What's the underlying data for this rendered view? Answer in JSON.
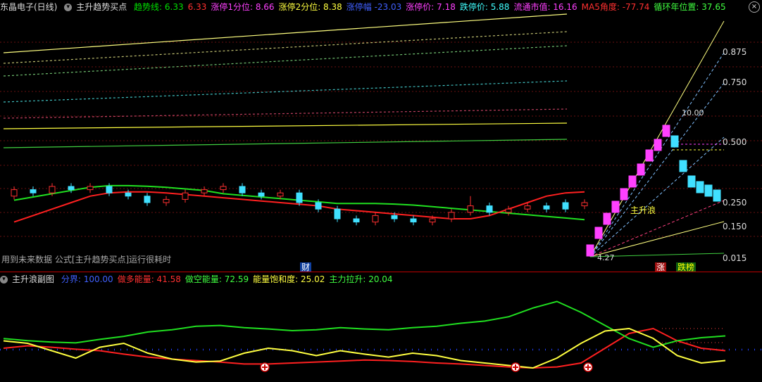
{
  "main": {
    "stock": "东晶电子(日线)",
    "indicator": "主升趋势买点",
    "params": [
      {
        "label": "趋势线:",
        "value": "6.33",
        "color": "#00e000"
      },
      {
        "label": "",
        "value": "6.33",
        "color": "#ff3030"
      },
      {
        "label": "涨停1分位:",
        "value": "8.66",
        "color": "#ff40ff"
      },
      {
        "label": "涨停2分位:",
        "value": "8.38",
        "color": "#ffff40"
      },
      {
        "label": "涨停幅",
        "value": "-23.03",
        "color": "#4060ff"
      },
      {
        "label": "涨停价:",
        "value": "7.18",
        "color": "#ff40ff"
      },
      {
        "label": "跌停价:",
        "value": "5.88",
        "color": "#40ffff"
      },
      {
        "label": "流通市值:",
        "value": "16.16",
        "color": "#ff40ff"
      },
      {
        "label": "MA5角度:",
        "value": "-77.74",
        "color": "#ff3030"
      },
      {
        "label": "循环年位置:",
        "value": "37.65",
        "color": "#40ff40"
      }
    ],
    "close": "×",
    "right_labels": [
      "0.875",
      "0.750",
      "0.500",
      "0.250",
      "0.150",
      "0.015"
    ],
    "note": "用到未来数据  公式[主升趋势买点]运行很耗时",
    "tags": [
      {
        "text": "财",
        "bg": "#1040a0",
        "color": "#fff"
      },
      {
        "text": "涨",
        "bg": "#a01010",
        "color": "#fff"
      },
      {
        "text": "跌榜",
        "bg": "#106010",
        "color": "#ff0"
      }
    ],
    "annot_high": "10.00",
    "annot_low": "4.27",
    "annot_wave": "主升浪"
  },
  "sub": {
    "name": "主升浪副图",
    "params": [
      {
        "label": "分界:",
        "value": "100.00",
        "color": "#4060ff"
      },
      {
        "label": "做多能量:",
        "value": "41.58",
        "color": "#ff3030"
      },
      {
        "label": "做空能量:",
        "value": "72.59",
        "color": "#40ff40"
      },
      {
        "label": "能量饱和度:",
        "value": "25.02",
        "color": "#ffff40"
      },
      {
        "label": "主力拉升:",
        "value": "20.04",
        "color": "#40ff40"
      }
    ]
  },
  "chart_data": [
    {
      "type": "candlestick",
      "series": [
        {
          "name": "趋势线",
          "values": [
            5.9,
            6.0,
            6.1,
            6.2,
            6.3,
            6.35,
            6.35,
            6.33,
            6.3,
            6.25,
            6.2,
            6.1,
            6.05,
            6.0,
            5.95,
            5.9,
            5.85,
            5.8,
            5.8,
            5.8,
            5.78,
            5.75,
            5.7,
            5.65,
            5.6,
            5.55,
            5.5,
            5.45,
            5.4,
            5.35,
            5.3
          ]
        },
        {
          "name": "",
          "values": [
            5.4,
            5.6,
            5.8,
            6.0,
            6.2,
            6.3,
            6.33,
            6.33,
            6.3,
            6.25,
            6.2,
            6.15,
            6.1,
            6.05,
            6.0,
            5.95,
            5.9,
            5.8,
            5.75,
            5.7,
            5.65,
            5.6,
            5.55,
            5.5,
            5.5,
            5.6,
            5.8,
            6.0,
            6.2,
            6.3,
            6.33
          ]
        }
      ],
      "candles": [
        [
          6.2,
          6.4,
          6.5,
          6.1,
          "up"
        ],
        [
          6.4,
          6.3,
          6.5,
          6.2,
          "down"
        ],
        [
          6.3,
          6.5,
          6.6,
          6.2,
          "up"
        ],
        [
          6.5,
          6.4,
          6.6,
          6.3,
          "down"
        ],
        [
          6.4,
          6.5,
          6.6,
          6.3,
          "up"
        ],
        [
          6.5,
          6.3,
          6.6,
          6.2,
          "down"
        ],
        [
          6.3,
          6.2,
          6.4,
          6.1,
          "down"
        ],
        [
          6.2,
          6.0,
          6.3,
          5.9,
          "down"
        ],
        [
          6.0,
          6.1,
          6.2,
          5.9,
          "up"
        ],
        [
          6.1,
          6.3,
          6.4,
          6.0,
          "up"
        ],
        [
          6.3,
          6.4,
          6.5,
          6.2,
          "up"
        ],
        [
          6.4,
          6.5,
          6.6,
          6.3,
          "up"
        ],
        [
          6.5,
          6.3,
          6.6,
          6.2,
          "down"
        ],
        [
          6.3,
          6.2,
          6.4,
          6.1,
          "down"
        ],
        [
          6.2,
          6.3,
          6.4,
          6.1,
          "up"
        ],
        [
          6.3,
          6.0,
          6.4,
          5.9,
          "down"
        ],
        [
          6.0,
          5.8,
          6.1,
          5.7,
          "down"
        ],
        [
          5.8,
          5.5,
          5.9,
          5.4,
          "down"
        ],
        [
          5.5,
          5.4,
          5.6,
          5.3,
          "down"
        ],
        [
          5.4,
          5.6,
          5.7,
          5.3,
          "up"
        ],
        [
          5.6,
          5.5,
          5.7,
          5.4,
          "down"
        ],
        [
          5.5,
          5.4,
          5.6,
          5.3,
          "down"
        ],
        [
          5.4,
          5.5,
          5.6,
          5.3,
          "up"
        ],
        [
          5.5,
          5.7,
          5.8,
          5.4,
          "up"
        ],
        [
          5.7,
          5.9,
          6.2,
          5.6,
          "up"
        ],
        [
          5.9,
          5.7,
          6.0,
          5.6,
          "down"
        ],
        [
          5.7,
          5.8,
          5.9,
          5.6,
          "up"
        ],
        [
          5.8,
          5.9,
          6.0,
          5.7,
          "up"
        ],
        [
          5.9,
          5.8,
          6.0,
          5.7,
          "down"
        ],
        [
          5.8,
          6.0,
          6.1,
          5.7,
          "down"
        ],
        [
          6.0,
          5.9,
          6.1,
          5.8,
          "up"
        ]
      ]
    },
    {
      "type": "line",
      "series": [
        {
          "name": "分界",
          "values": [
            100,
            100,
            100,
            100,
            100,
            100,
            100,
            100,
            100,
            100,
            100,
            100,
            100,
            100,
            100,
            100,
            100,
            100,
            100,
            100,
            100,
            100,
            100,
            100,
            100,
            100,
            100,
            100,
            100,
            100,
            100
          ]
        },
        {
          "name": "做多能量",
          "values": [
            60,
            65,
            62,
            58,
            55,
            48,
            42,
            38,
            35,
            32,
            28,
            28,
            30,
            32,
            34,
            36,
            35,
            33,
            30,
            28,
            25,
            22,
            20,
            22,
            30,
            60,
            90,
            100,
            75,
            60,
            55
          ]
        },
        {
          "name": "做空能量",
          "values": [
            90,
            85,
            82,
            80,
            88,
            95,
            105,
            110,
            118,
            120,
            115,
            112,
            108,
            110,
            115,
            112,
            110,
            115,
            118,
            125,
            130,
            140,
            160,
            175,
            150,
            120,
            90,
            70,
            85,
            92,
            96
          ]
        },
        {
          "name": "能量饱和度",
          "values": [
            75,
            70,
            55,
            40,
            62,
            70,
            50,
            38,
            32,
            34,
            50,
            60,
            55,
            45,
            55,
            48,
            42,
            50,
            45,
            35,
            30,
            25,
            20,
            40,
            70,
            95,
            100,
            80,
            45,
            30,
            35
          ]
        }
      ]
    }
  ]
}
